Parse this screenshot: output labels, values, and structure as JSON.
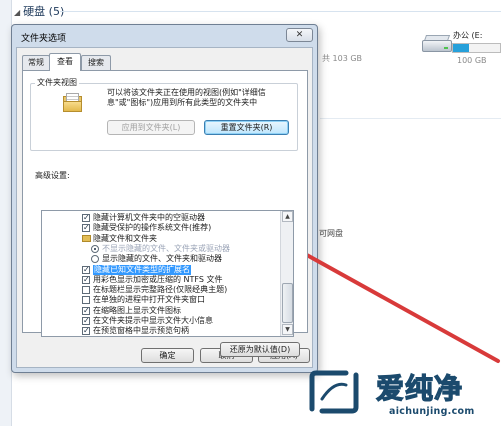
{
  "background": {
    "section_title": "硬盘 (5)",
    "drive_name": "办公 (E:",
    "drive_free_left": "共 103 GB",
    "drive_free_right": "100 GB",
    "partial_label": "可网盘",
    "drive_bar_fill_percent": 35
  },
  "dialog": {
    "title": "文件夹选项",
    "close_label": "✕",
    "tabs": [
      {
        "label": "常规",
        "active": false
      },
      {
        "label": "查看",
        "active": true
      },
      {
        "label": "搜索",
        "active": false
      }
    ],
    "folder_view": {
      "group_label": "文件夹视图",
      "description_lines": [
        "可以将该文件夹正在使用的视图(例如\"详细信",
        "息\"或\"图标\")应用到所有此类型的文件夹中"
      ],
      "apply_button": "应用到文件夹(L)",
      "reset_button": "重置文件夹(R)"
    },
    "advanced": {
      "label": "高级设置:",
      "items": [
        {
          "kind": "checkbox",
          "checked": true,
          "level": 1,
          "text": "隐藏计算机文件夹中的空驱动器",
          "state": "normal"
        },
        {
          "kind": "checkbox",
          "checked": true,
          "level": 1,
          "text": "隐藏受保护的操作系统文件(推荐)",
          "state": "normal"
        },
        {
          "kind": "folder",
          "checked": false,
          "level": 1,
          "text": "隐藏文件和文件夹",
          "state": "normal"
        },
        {
          "kind": "radio",
          "checked": true,
          "level": 2,
          "text": "不显示隐藏的文件、文件夹或驱动器",
          "state": "obscured"
        },
        {
          "kind": "radio",
          "checked": false,
          "level": 2,
          "text": "显示隐藏的文件、文件夹和驱动器",
          "state": "normal"
        },
        {
          "kind": "checkbox",
          "checked": true,
          "level": 1,
          "text": "隐藏已知文件类型的扩展名",
          "state": "highlighted"
        },
        {
          "kind": "checkbox",
          "checked": true,
          "level": 1,
          "text": "用彩色显示加密或压缩的 NTFS 文件",
          "state": "normal"
        },
        {
          "kind": "checkbox",
          "checked": false,
          "level": 1,
          "text": "在标题栏显示完整路径(仅限经典主题)",
          "state": "normal"
        },
        {
          "kind": "checkbox",
          "checked": false,
          "level": 1,
          "text": "在单独的进程中打开文件夹窗口",
          "state": "normal"
        },
        {
          "kind": "checkbox",
          "checked": true,
          "level": 1,
          "text": "在缩略图上显示文件图标",
          "state": "normal"
        },
        {
          "kind": "checkbox",
          "checked": true,
          "level": 1,
          "text": "在文件夹提示中显示文件大小信息",
          "state": "normal"
        },
        {
          "kind": "checkbox",
          "checked": true,
          "level": 1,
          "text": "在预览窗格中显示预览句柄",
          "state": "normal"
        }
      ]
    },
    "restore_button": "还原为默认值(D)",
    "ok_button": "确定",
    "cancel_button": "取消",
    "apply_button": "应用(A)"
  },
  "watermark": {
    "brand": "爱纯净",
    "url": "aichunjing.com"
  },
  "colors": {
    "annotation_red": "#d83a3a",
    "selection_blue": "#3399ff",
    "watermark_blue": "#1b4a6d"
  },
  "icons": [
    "folder-icon",
    "drive-icon",
    "close-icon",
    "scroll-up-icon",
    "scroll-down-icon",
    "annotation-arrow-icon",
    "watermark-logo-icon"
  ]
}
